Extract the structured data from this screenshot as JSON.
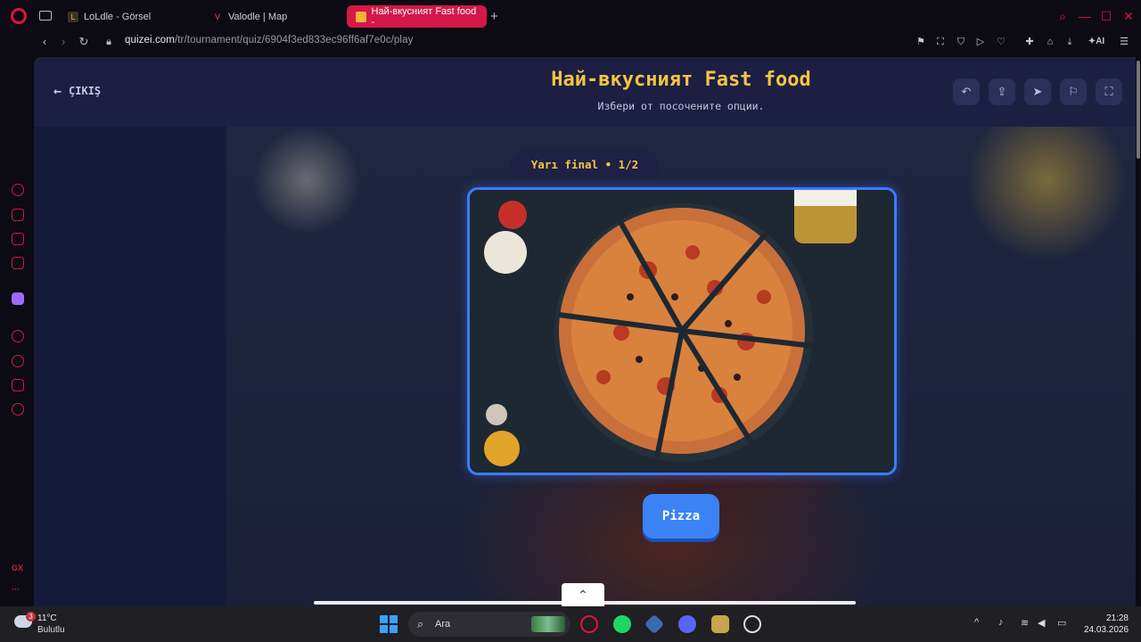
{
  "browser": {
    "tabs": [
      {
        "label": "LoLdle - Görsel",
        "active": false
      },
      {
        "label": "Valodle | Map",
        "active": false
      },
      {
        "label": "Най-вкусният Fast food -",
        "active": true
      }
    ],
    "url_host": "quizei.com",
    "url_path": "/tr/tournament/quiz/6904f3ed833ec96ff6af7e0c/play",
    "ai_label": "AI"
  },
  "quiz": {
    "exit_label": "ÇIKIŞ",
    "title": "Най-вкусният Fast food",
    "subtitle": "Избери от посочените опции.",
    "round_label": "Yarı final • 1/2",
    "choice_label": "Pizza"
  },
  "taskbar": {
    "weather_temp": "11°C",
    "weather_desc": "Bulutlu",
    "weather_badge": "3",
    "search_placeholder": "Ara",
    "time": "21:28",
    "date": "24.03.2026"
  },
  "colors": {
    "accent_red": "#e0143c",
    "title_yellow": "#f5c542",
    "button_blue": "#3b82f6",
    "page_bg": "#151633"
  }
}
